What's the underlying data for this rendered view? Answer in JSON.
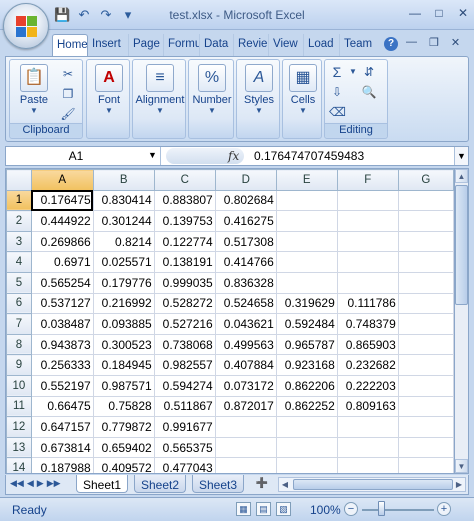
{
  "window": {
    "title": "test.xlsx - Microsoft Excel",
    "qat_icons": [
      "save-icon",
      "undo-icon",
      "redo-icon",
      "customize-icon"
    ],
    "controls": [
      "minimize-icon",
      "maximize-icon",
      "close-icon"
    ]
  },
  "ribbon": {
    "tabs": [
      "Home",
      "Insert",
      "Page",
      "Formu",
      "Data",
      "Revie",
      "View",
      "Load",
      "Team"
    ],
    "active_tab": "Home",
    "groups": {
      "clipboard": {
        "label": "Clipboard",
        "paste": "Paste"
      },
      "font": {
        "label": "Font"
      },
      "alignment": {
        "label": "Alignment"
      },
      "number": {
        "label": "Number",
        "glyph": "%"
      },
      "styles": {
        "label": "Styles"
      },
      "cells": {
        "label": "Cells"
      },
      "editing": {
        "label": "Editing"
      }
    }
  },
  "formula_bar": {
    "name_box": "A1",
    "fx": "fx",
    "value": "0.176474707459483"
  },
  "sheet": {
    "columns": [
      "A",
      "B",
      "C",
      "D",
      "E",
      "F",
      "G"
    ],
    "selected_column": "A",
    "selected_row": "1",
    "rows": [
      {
        "num": "1",
        "cells": [
          "0.176475",
          "0.830414",
          "0.883807",
          "0.802684",
          "",
          "",
          ""
        ]
      },
      {
        "num": "2",
        "cells": [
          "0.444922",
          "0.301244",
          "0.139753",
          "0.416275",
          "",
          "",
          ""
        ]
      },
      {
        "num": "3",
        "cells": [
          "0.269866",
          "0.8214",
          "0.122774",
          "0.517308",
          "",
          "",
          ""
        ]
      },
      {
        "num": "4",
        "cells": [
          "0.6971",
          "0.025571",
          "0.138191",
          "0.414766",
          "",
          "",
          ""
        ]
      },
      {
        "num": "5",
        "cells": [
          "0.565254",
          "0.179776",
          "0.999035",
          "0.836328",
          "",
          "",
          ""
        ]
      },
      {
        "num": "6",
        "cells": [
          "0.537127",
          "0.216992",
          "0.528272",
          "0.524658",
          "0.319629",
          "0.111786",
          ""
        ]
      },
      {
        "num": "7",
        "cells": [
          "0.038487",
          "0.093885",
          "0.527216",
          "0.043621",
          "0.592484",
          "0.748379",
          ""
        ]
      },
      {
        "num": "8",
        "cells": [
          "0.943873",
          "0.300523",
          "0.738068",
          "0.499563",
          "0.965787",
          "0.865903",
          ""
        ]
      },
      {
        "num": "9",
        "cells": [
          "0.256333",
          "0.184945",
          "0.982557",
          "0.407884",
          "0.923168",
          "0.232682",
          ""
        ]
      },
      {
        "num": "10",
        "cells": [
          "0.552197",
          "0.987571",
          "0.594274",
          "0.073172",
          "0.862206",
          "0.222203",
          ""
        ]
      },
      {
        "num": "11",
        "cells": [
          "0.66475",
          "0.75828",
          "0.511867",
          "0.872017",
          "0.862252",
          "0.809163",
          ""
        ]
      },
      {
        "num": "12",
        "cells": [
          "0.647157",
          "0.779872",
          "0.991677",
          "",
          "",
          "",
          ""
        ]
      },
      {
        "num": "13",
        "cells": [
          "0.673814",
          "0.659402",
          "0.565375",
          "",
          "",
          "",
          ""
        ]
      },
      {
        "num": "14",
        "cells": [
          "0.187988",
          "0.409572",
          "0.477043",
          "",
          "",
          "",
          ""
        ]
      }
    ],
    "tabs": [
      "Sheet1",
      "Sheet2",
      "Sheet3"
    ],
    "active_tab": "Sheet1"
  },
  "status": {
    "text": "Ready",
    "zoom": "100%",
    "zoom_level_percent": 100
  }
}
